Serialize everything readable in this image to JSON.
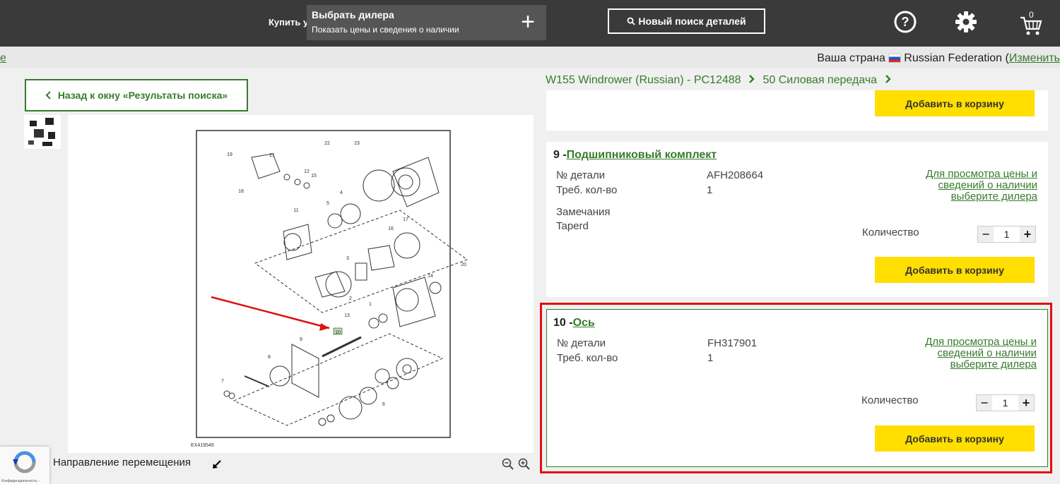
{
  "header": {
    "buy_label": "Купить у",
    "dealer_title": "Выбрать дилера",
    "dealer_sub": "Показать цены и сведения о наличии",
    "new_search": "Новый поиск деталей",
    "cart_count": "0"
  },
  "country": {
    "prefix": "Ваша страна",
    "name": "Russian Federation",
    "paren_open": "(",
    "change": "Изменить"
  },
  "back_button": "Назад к окну «Результаты поиска»",
  "breadcrumb": [
    "W155 Windrower (Russian) - PC12488",
    "50 Силовая передача"
  ],
  "diagram": {
    "code": "EX419549",
    "highlighted_callout": "10",
    "callouts": [
      "19",
      "21",
      "22",
      "23",
      "12",
      "15",
      "18",
      "11",
      "5",
      "4",
      "17",
      "16",
      "3",
      "2",
      "20",
      "14",
      "1",
      "13",
      "10",
      "9",
      "8",
      "7",
      "6"
    ]
  },
  "viewer": {
    "nav_label": "Направление перемещения"
  },
  "recaptcha": {
    "text": "Конфиденциальность -"
  },
  "items": [
    {
      "add_label": "Добавить в корзину"
    },
    {
      "number": "9 -",
      "name": "Подшипниковый комплект",
      "part_label": "№ детали",
      "part_value": "AFH208664",
      "qty_label": "Треб. кол-во",
      "qty_value": "1",
      "remarks_label": "Замечания",
      "remarks_value": "Taperd",
      "price_link": "Для просмотра цены и сведений о наличии выберите дилера",
      "quantity_label": "Количество",
      "quantity": "1",
      "add_label": "Добавить в корзину"
    },
    {
      "number": "10 -",
      "name": "Ось",
      "part_label": "№ детали",
      "part_value": "FH317901",
      "qty_label": "Треб. кол-во",
      "qty_value": "1",
      "price_link": "Для просмотра цены и сведений о наличии выберите дилера",
      "quantity_label": "Количество",
      "quantity": "1",
      "add_label": "Добавить в корзину"
    }
  ],
  "colors": {
    "header_bg": "#3a3a3a",
    "brand_green": "#367c2b",
    "button_yellow": "#ffde00",
    "highlight_red": "#e01010"
  }
}
